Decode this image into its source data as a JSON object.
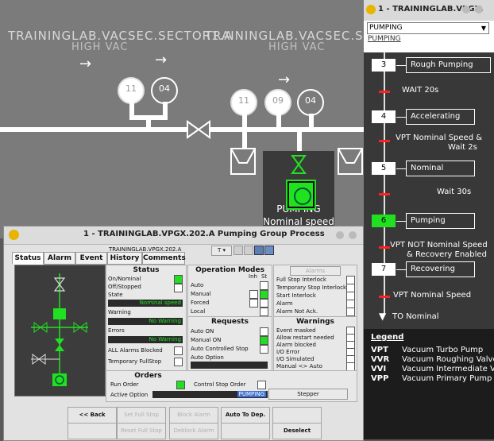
{
  "synoptic": {
    "sector1_title": "TRAININGLAB.VACSEC.SECTOR1.A",
    "sector1_sub": "HIGH VAC",
    "sector2_title": "TRAININGLAB.VACSEC.SECTOR",
    "sector2_sub": "HIGH VAC",
    "gauges": [
      "11",
      "04",
      "11",
      "09",
      "04"
    ],
    "pump_state": "PUMPING",
    "pump_sub": "Nominal speed"
  },
  "right_panel": {
    "title": "1 - TRAININGLAB.VPGX.",
    "select_value": "PUMPING",
    "heading": "PUMPING",
    "steps": [
      {
        "num": "3",
        "label": "Rough Pumping",
        "active": false
      },
      {
        "num": "4",
        "label": "Accelerating",
        "active": false
      },
      {
        "num": "5",
        "label": "Nominal",
        "active": false
      },
      {
        "num": "6",
        "label": "Pumping",
        "active": true
      },
      {
        "num": "7",
        "label": "Recovering",
        "active": false
      }
    ],
    "transitions": {
      "t1": "WAIT 20s",
      "t2a": "VPT Nominal Speed &",
      "t2b": "Wait 2s",
      "t3": "Wait 30s",
      "t4a": "VPT NOT Nominal Speed",
      "t4b": "& Recovery Enabled",
      "t5": "VPT Nominal Speed",
      "end": "TO Nominal"
    },
    "legend_title": "Legend",
    "legend": [
      {
        "key": "VPT",
        "value": "Vacuum Turbo Pump"
      },
      {
        "key": "VVR",
        "value": "Vacuum Roughing Valve"
      },
      {
        "key": "VVI",
        "value": "Vacuum Intermediate Valve"
      },
      {
        "key": "VPP",
        "value": "Vacuum Primary Pump"
      }
    ]
  },
  "dialog": {
    "title": "1 - TRAININGLAB.VPGX.202.A Pumping Group Process",
    "tabs": [
      "Status",
      "Alarm",
      "Event",
      "History",
      "Comments"
    ],
    "device_name": "TRAININGLAB.VPGX.202.A",
    "t_dropdown": "T",
    "status": {
      "title": "Status",
      "on_nominal": "On/Nominal",
      "off_stopped": "Off/Stopped",
      "state": "State",
      "state_value": "Nominal speed",
      "warning": "Warning",
      "warning_value": "No Warning",
      "errors": "Errors",
      "errors_value": "No Warning",
      "all_alarms_blocked": "ALL Alarms Blocked",
      "temporary_fullstop": "Temporary FullStop"
    },
    "opmodes": {
      "title": "Operation Modes",
      "inh": "Inh",
      "st": "St",
      "auto": "Auto",
      "manual": "Manual",
      "forced": "Forced",
      "local": "Local"
    },
    "requests": {
      "title": "Requests",
      "auto_on": "Auto ON",
      "manual_on": "Manual ON",
      "auto_controlled_stop": "Auto Controlled Stop",
      "auto_option": "Auto Option"
    },
    "alarms": {
      "button": "Alarms",
      "full_stop_interlock": "Full Stop Interlock",
      "temporary_stop_interlock": "Temporary Stop Interlock",
      "start_interlock": "Start Interlock",
      "alarm": "Alarm",
      "alarm_not_ack": "Alarm Not Ack."
    },
    "warnings": {
      "title": "Warnings",
      "event_masked": "Event masked",
      "allow_restart_needed": "Allow restart needed",
      "alarm_blocked": "Alarm blocked",
      "io_error": "I/O Error",
      "io_simulated": "I/O Simulated",
      "manual_auto": "Manual <> Auto"
    },
    "orders": {
      "title": "Orders",
      "run_order": "Run Order",
      "control_stop_order": "Control Stop Order",
      "active_option": "Active Option",
      "active_option_value": "PUMPING",
      "stepper": "Stepper"
    },
    "buttons": {
      "back": "<< Back",
      "set_full_stop": "Set Full Stop",
      "reset_full_stop": "Reset Full Stop",
      "block_alarm": "Block Alarm",
      "deblock_alarm": "Deblock Alarm",
      "auto_to_dep": "Auto To Dep.",
      "deselect": "Deselect"
    }
  }
}
